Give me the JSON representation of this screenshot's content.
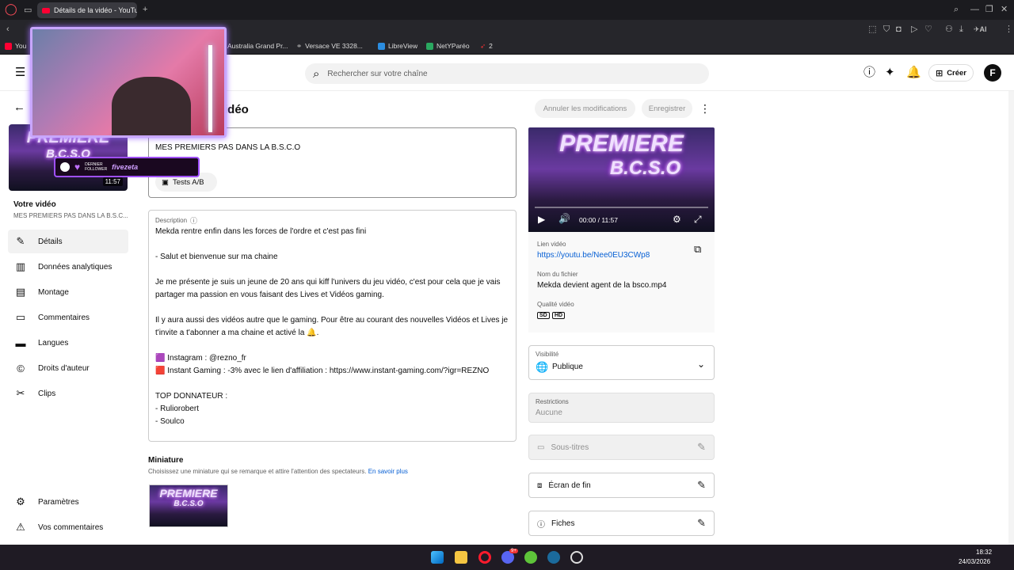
{
  "browser": {
    "tab_title": "Détails de la vidéo - YouTu",
    "bookmarks": [
      "You",
      "Australia Grand Pr...",
      "Versace VE 3328...",
      "LibreView",
      "NetYParéo",
      "2"
    ],
    "ai_label": "AI"
  },
  "header": {
    "search_placeholder": "Rechercher sur votre chaîne",
    "create_label": "Créer",
    "avatar_letter": "F"
  },
  "sidebar": {
    "video_duration": "11:57",
    "your_video_label": "Votre vidéo",
    "video_title": "MES PREMIERS PAS DANS LA B.S.C...",
    "items": [
      {
        "label": "Détails",
        "icon": "pencil-icon"
      },
      {
        "label": "Données analytiques",
        "icon": "analytics-icon"
      },
      {
        "label": "Montage",
        "icon": "film-icon"
      },
      {
        "label": "Commentaires",
        "icon": "comments-icon"
      },
      {
        "label": "Langues",
        "icon": "subtitles-icon"
      },
      {
        "label": "Droits d'auteur",
        "icon": "copyright-icon"
      },
      {
        "label": "Clips",
        "icon": "scissors-icon"
      }
    ],
    "bottom_items": [
      {
        "label": "Paramètres",
        "icon": "gear-icon"
      },
      {
        "label": "Vos commentaires",
        "icon": "feedback-icon"
      }
    ]
  },
  "main": {
    "page_title_partial": "idéo",
    "undo_label": "Annuler les modifications",
    "save_label": "Enregistrer",
    "title_value": "MES PREMIERS PAS DANS LA B.S.C.O",
    "ab_test_label": "Tests A/B",
    "description_label": "Description",
    "description_lines": [
      "Mekda rentre enfin dans les forces de l'ordre et c'est pas fini",
      "",
      "- Salut et bienvenue sur ma chaine",
      "",
      "Je me présente je suis un jeune de 20 ans qui kiff l'univers du jeu vidéo, c'est pour cela que je vais",
      "partager ma passion en vous faisant des Lives et Vidéos gaming.",
      "",
      "Il y aura aussi des vidéos autre que le gaming. Pour être au courant des nouvelles Vidéos et Lives je",
      "t'invite a t'abonner a ma chaine et activé la 🔔.",
      "",
      "🟪 Instagram : @rezno_fr",
      "🟥 Instant Gaming : -3% avec le lien d'affiliation : https://www.instant-gaming.com/?igr=REZNO",
      "",
      "TOP DONNATEUR :",
      "- Ruliorobert",
      "- Soulco"
    ],
    "thumbnail_heading": "Miniature",
    "thumbnail_help": "Choisissez une miniature qui se remarque et attire l'attention des spectateurs.",
    "learn_more": "En savoir plus",
    "thumb_text_line1": "PREMIERE",
    "thumb_text_line2": "B.C.S.O"
  },
  "right": {
    "player_time": "00:00 / 11:57",
    "video_link_label": "Lien vidéo",
    "video_link": "https://youtu.be/Nee0EU3CWp8",
    "filename_label": "Nom du fichier",
    "filename": "Mekda devient agent de la bsco.mp4",
    "quality_label": "Qualité vidéo",
    "quality_sd": "SD",
    "quality_hd": "HD",
    "visibility_label": "Visibilité",
    "visibility_value": "Publique",
    "restrictions_label": "Restrictions",
    "restrictions_value": "Aucune",
    "subtitles_label": "Sous-titres",
    "end_screen_label": "Écran de fin",
    "cards_label": "Fiches",
    "hero_line1": "PREMIERE",
    "hero_line2": "B.C.S.O"
  },
  "overlay": {
    "follower_tag": "DERNIER FOLLOWER",
    "follower_name": "fivezeta"
  },
  "taskbar": {
    "time": "18:32",
    "date": "24/03/2026",
    "badge": "9+"
  },
  "colors": {
    "link": "#065fd4",
    "brand_red": "#ff0033",
    "overlay_purple": "#a050ff"
  }
}
